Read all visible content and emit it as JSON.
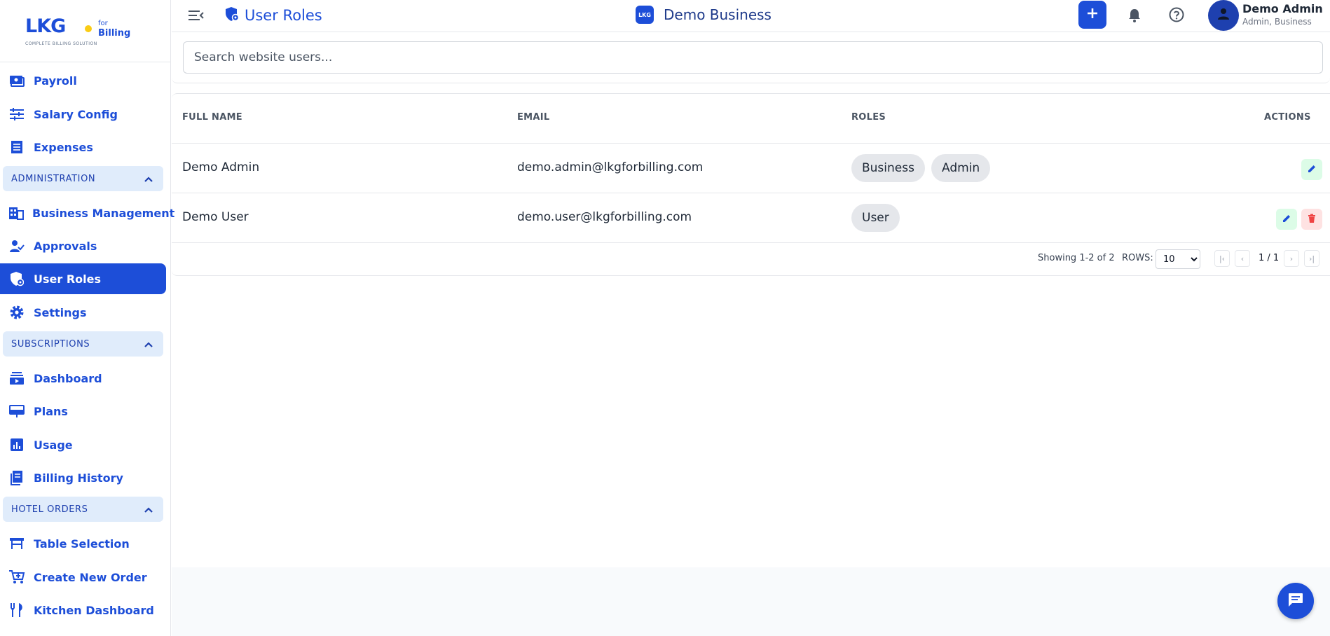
{
  "brand": {
    "logo": "LKG",
    "tagline": "COMPLETE BILLING SOLUTION",
    "for": "for",
    "billing": "Billing",
    "accent": "#1d4ed8"
  },
  "sidebar": {
    "items_top": [
      {
        "label": "Payroll",
        "icon": "payroll-icon"
      },
      {
        "label": "Salary Config",
        "icon": "sliders-icon"
      },
      {
        "label": "Expenses",
        "icon": "receipt-icon"
      }
    ],
    "sections": [
      {
        "label": "ADMINISTRATION",
        "items": [
          {
            "label": "Business Management",
            "icon": "building-icon"
          },
          {
            "label": "Approvals",
            "icon": "user-check-icon"
          },
          {
            "label": "User Roles",
            "icon": "shield-icon",
            "active": true
          },
          {
            "label": "Settings",
            "icon": "gear-icon"
          }
        ]
      },
      {
        "label": "SUBSCRIPTIONS",
        "items": [
          {
            "label": "Dashboard",
            "icon": "subscriptions-icon"
          },
          {
            "label": "Plans",
            "icon": "plans-icon"
          },
          {
            "label": "Usage",
            "icon": "bar-chart-icon"
          },
          {
            "label": "Billing History",
            "icon": "history-icon"
          }
        ]
      },
      {
        "label": "HOTEL ORDERS",
        "items": [
          {
            "label": "Table Selection",
            "icon": "table-icon"
          },
          {
            "label": "Create New Order",
            "icon": "cart-icon"
          },
          {
            "label": "Kitchen Dashboard",
            "icon": "fork-knife-icon"
          }
        ]
      }
    ]
  },
  "header": {
    "page_title": "User Roles",
    "business_logo": "LKG",
    "business_name": "Demo Business",
    "user_name": "Demo Admin",
    "user_roles": "Admin, Business"
  },
  "search": {
    "placeholder": "Search website users..."
  },
  "table": {
    "columns": [
      "FULL NAME",
      "EMAIL",
      "ROLES",
      "ACTIONS"
    ],
    "rows": [
      {
        "name": "Demo Admin",
        "email": "demo.admin@lkgforbilling.com",
        "roles": [
          "Business",
          "Admin"
        ],
        "actions": [
          "edit"
        ]
      },
      {
        "name": "Demo User",
        "email": "demo.user@lkgforbilling.com",
        "roles": [
          "User"
        ],
        "actions": [
          "edit",
          "delete"
        ]
      }
    ],
    "pagination": {
      "showing": "Showing 1-2 of 2",
      "rows_label": "ROWS:",
      "rows_value": "10",
      "page": "1 / 1"
    }
  }
}
